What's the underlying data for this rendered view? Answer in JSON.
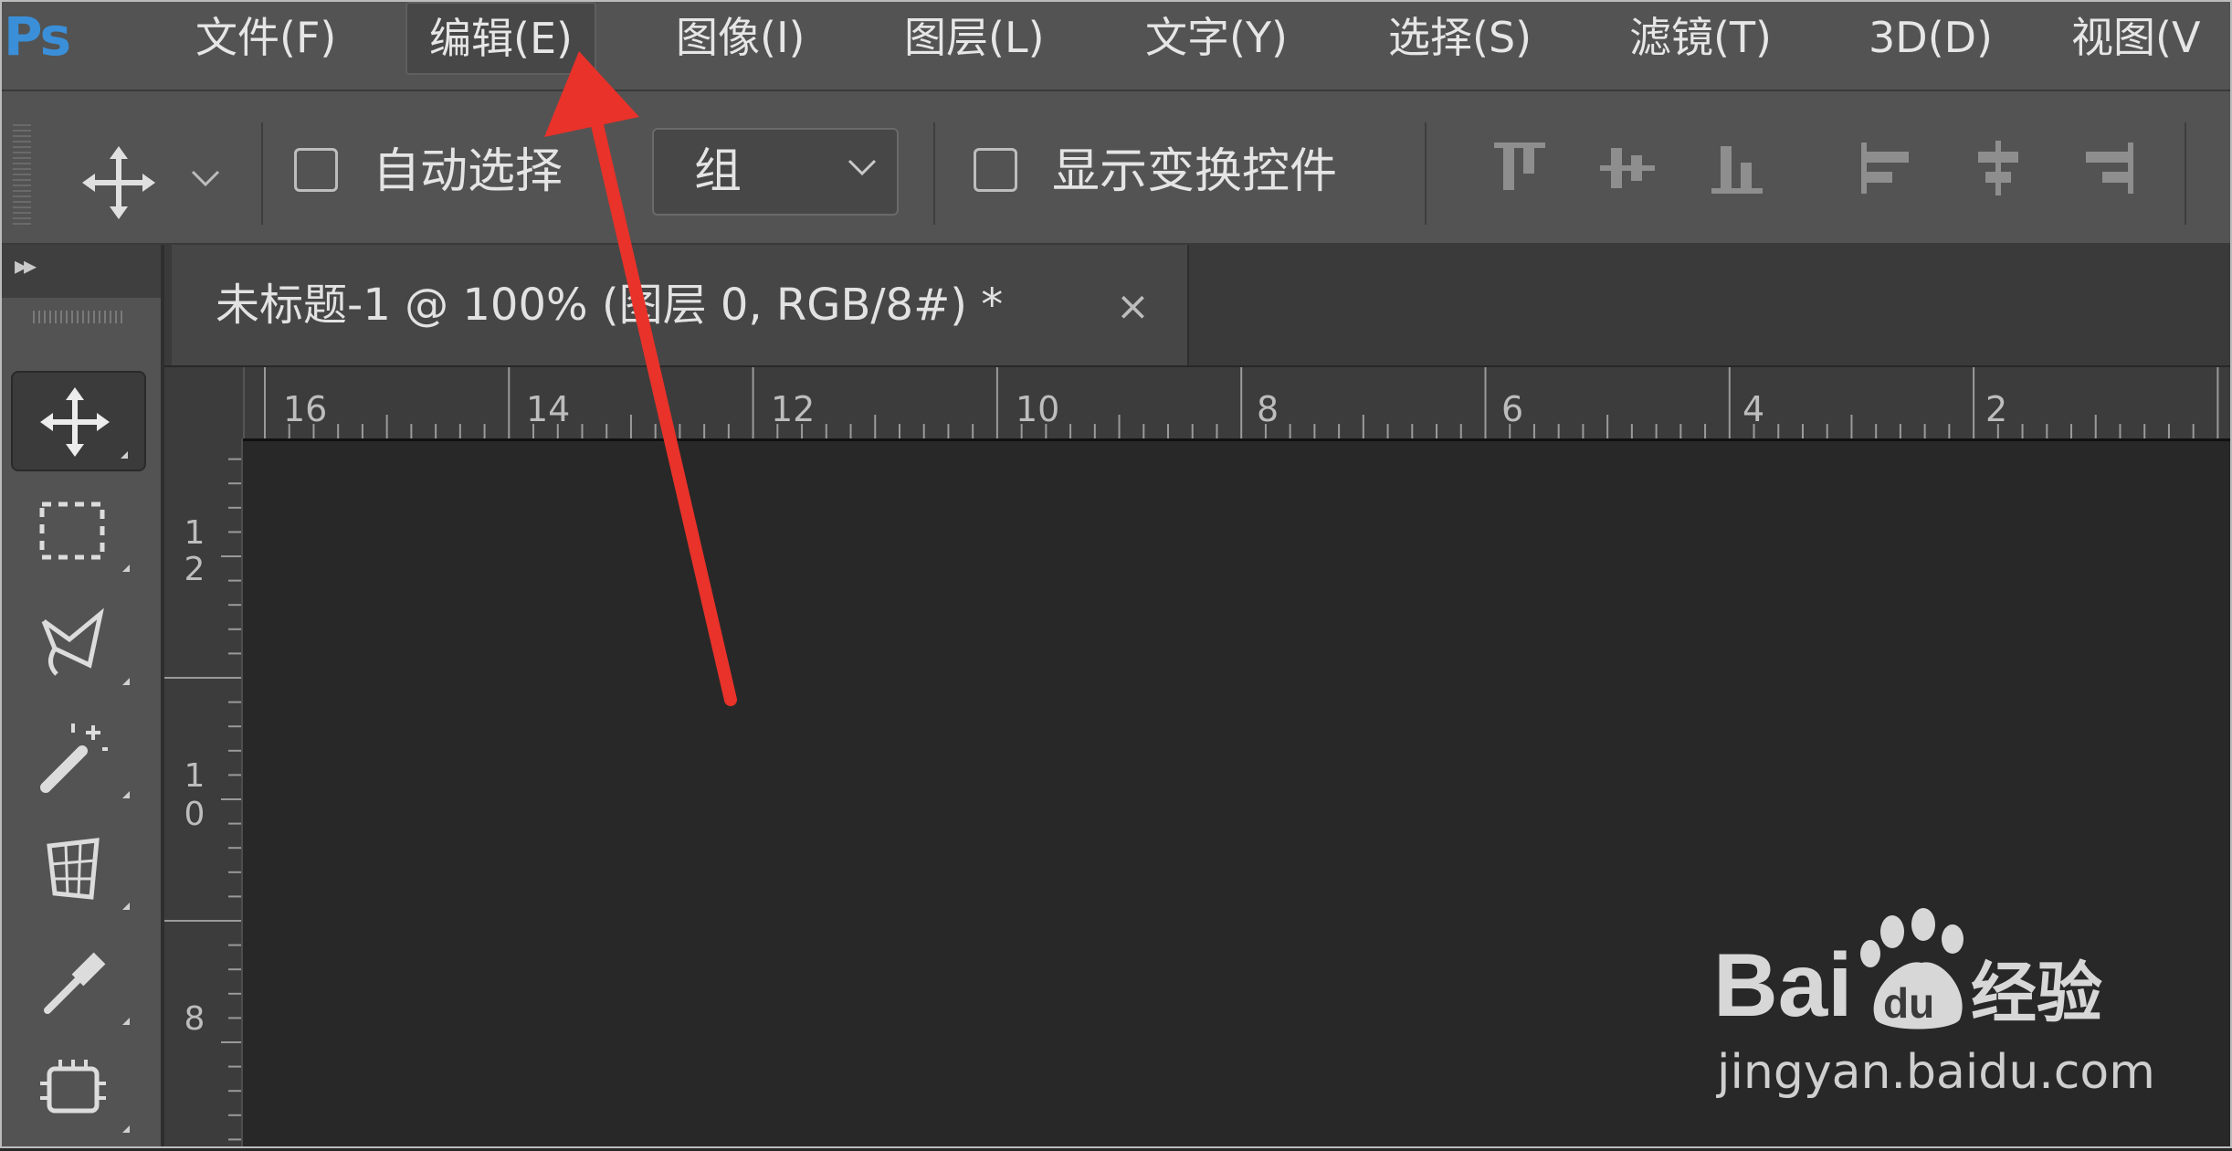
{
  "app": {
    "logo": "Ps"
  },
  "menu": [
    "文件(F)",
    "编辑(E)",
    "图像(I)",
    "图层(L)",
    "文字(Y)",
    "选择(S)",
    "滤镜(T)",
    "3D(D)",
    "视图(V"
  ],
  "options": {
    "auto_select_label": "自动选择",
    "auto_select_checked": false,
    "group_select_value": "组",
    "show_transform_label": "显示变换控件",
    "show_transform_checked": false
  },
  "document": {
    "tab_title": "未标题-1 @ 100% (图层 0, RGB/8#) *",
    "close_symbol": "×"
  },
  "rulers": {
    "top": [
      "16",
      "14",
      "12",
      "10",
      "8",
      "6",
      "4",
      "2"
    ],
    "left": [
      [
        "1",
        "2"
      ],
      [
        "1",
        "0"
      ],
      [
        "8"
      ]
    ]
  },
  "watermark": {
    "brand": "Bai",
    "brand_tail": "du",
    "product": "经验",
    "url": "jingyan.baidu.com"
  },
  "colors": {
    "annotation_arrow": "#e8322a",
    "ps_logo": "#3a8fd8"
  }
}
